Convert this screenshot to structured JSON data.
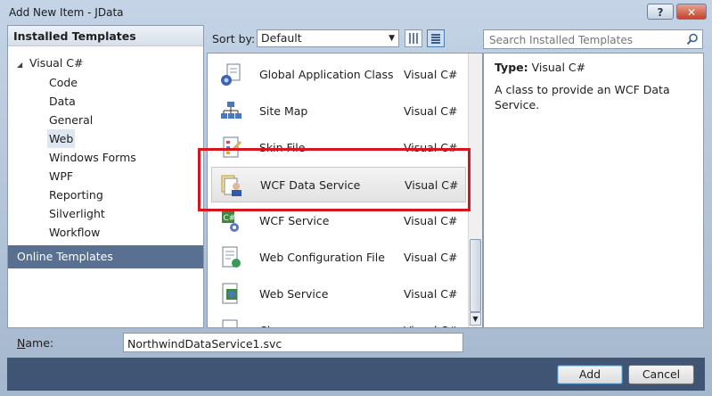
{
  "window": {
    "title": "Add New Item - JData",
    "help_label": "?",
    "close_label": "✕"
  },
  "left_panel": {
    "header": "Installed Templates",
    "root": "Visual C#",
    "items": [
      {
        "label": "Code"
      },
      {
        "label": "Data"
      },
      {
        "label": "General"
      },
      {
        "label": "Web",
        "selected": true
      },
      {
        "label": "Windows Forms"
      },
      {
        "label": "WPF"
      },
      {
        "label": "Reporting"
      },
      {
        "label": "Silverlight"
      },
      {
        "label": "Workflow"
      }
    ],
    "online": "Online Templates"
  },
  "toolbar": {
    "sort_label": "Sort by:",
    "sort_value": "Default"
  },
  "search": {
    "placeholder": "Search Installed Templates"
  },
  "templates": [
    {
      "name": "Global Application Class",
      "type": "Visual C#",
      "icon": "global-class-icon"
    },
    {
      "name": "Site Map",
      "type": "Visual C#",
      "icon": "site-map-icon"
    },
    {
      "name": "Skin File",
      "type": "Visual C#",
      "icon": "skin-file-icon"
    },
    {
      "name": "WCF Data Service",
      "type": "Visual C#",
      "icon": "wcf-data-service-icon",
      "selected": true
    },
    {
      "name": "WCF Service",
      "type": "Visual C#",
      "icon": "wcf-service-icon"
    },
    {
      "name": "Web Configuration File",
      "type": "Visual C#",
      "icon": "web-config-icon"
    },
    {
      "name": "Web Service",
      "type": "Visual C#",
      "icon": "web-service-icon"
    },
    {
      "name": "Class",
      "type": "Visual C#",
      "icon": "class-icon"
    }
  ],
  "details": {
    "type_label": "Type:",
    "type_value": "Visual C#",
    "description": "A class to provide an WCF Data Service."
  },
  "name_field": {
    "label_prefix": "N",
    "label_rest": "ame:",
    "value": "NorthwindDataService1.svc"
  },
  "buttons": {
    "add": "Add",
    "cancel": "Cancel"
  },
  "colors": {
    "highlight": "#d8141c",
    "footer": "#3f5573",
    "online_bar": "#5a7090"
  }
}
